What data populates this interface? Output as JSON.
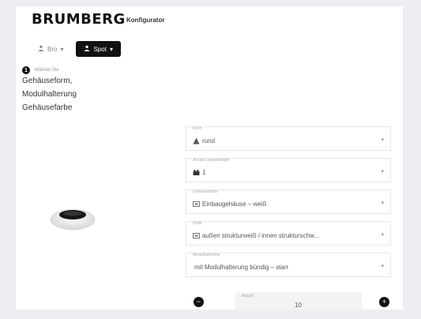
{
  "brand": {
    "name": "BRUMBERG",
    "subtitle": "Konfigurator"
  },
  "modes": [
    {
      "label": "Bro",
      "icon": "person-icon",
      "chevron": "▾"
    },
    {
      "label": "Spot",
      "icon": "person-icon",
      "chevron": "▾"
    }
  ],
  "steps": {
    "index": "1",
    "hint": "Wählen Sie",
    "items": [
      "Gehäuseform,",
      "Modulhalterung",
      "Gehäusefarbe"
    ]
  },
  "fields": [
    {
      "label": "Form",
      "icon": "triangle-icon",
      "value": "rund"
    },
    {
      "label": "Anzahl Lampenköpfe",
      "icon": "spot-head-icon",
      "value": "1"
    },
    {
      "label": "Gehäusefarbe",
      "icon": "housing-icon",
      "value": "Einbaugehäuse – weiß"
    },
    {
      "label": "Optik",
      "icon": "optic-icon",
      "value": "außen strukturweiß / innen strukturschw..."
    },
    {
      "label": "Modulhalterung",
      "icon": "",
      "value": "mit Modulhalterung bündig – starr"
    }
  ],
  "quantity": {
    "label": "Anzahl",
    "value": "10",
    "minus": "−",
    "plus": "+"
  },
  "colors": {
    "accent": "#111111",
    "background": "#eceef1"
  }
}
